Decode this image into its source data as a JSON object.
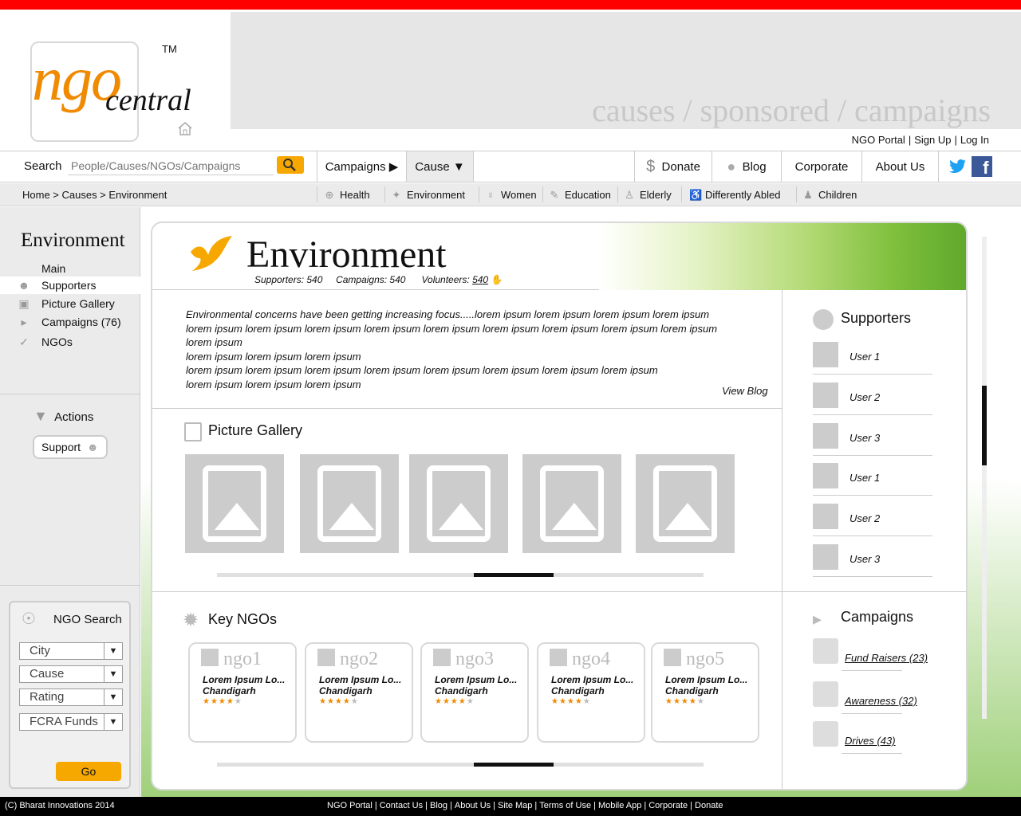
{
  "logo": {
    "word1": "ngo",
    "word2": "central",
    "tm": "TM"
  },
  "banner": {
    "tagline": "causes / sponsored / campaigns"
  },
  "top_links": [
    "NGO Portal",
    "Sign Up",
    "Log In"
  ],
  "search": {
    "label": "Search",
    "placeholder": "People/Causes/NGOs/Campaigns"
  },
  "nav": {
    "campaigns": "Campaigns",
    "cause": "Cause",
    "donate": "Donate",
    "blog": "Blog",
    "corporate": "Corporate",
    "about": "About Us"
  },
  "breadcrumb": "Home > Causes > Environment",
  "categories": [
    "Health",
    "Environment",
    "Women",
    "Education",
    "Elderly",
    "Differently Abled",
    "Children"
  ],
  "sidebar": {
    "title": "Environment",
    "items": [
      "Main",
      "Supporters",
      "Picture Gallery",
      "Campaigns (76)",
      "NGOs"
    ],
    "actions": "Actions",
    "support": "Support"
  },
  "ngo_search": {
    "title": "NGO Search",
    "filters": [
      "City",
      "Cause",
      "Rating",
      "FCRA Funds"
    ],
    "go": "Go"
  },
  "hero": {
    "title": "Environment",
    "supporters": "Supporters: 540",
    "campaigns": "Campaigns: 540",
    "volunteers_label": "Volunteers:",
    "volunteers_value": "540"
  },
  "description": [
    "Environmental concerns have been getting increasing focus.....lorem ipsum lorem ipsum lorem ipsum lorem ipsum",
    "lorem ipsum lorem ipsum lorem ipsum lorem ipsum lorem ipsum lorem ipsum lorem ipsum lorem ipsum lorem ipsum lorem ipsum",
    "lorem ipsum lorem ipsum lorem ipsum",
    "lorem ipsum lorem ipsum lorem ipsum lorem ipsum lorem ipsum lorem ipsum lorem ipsum lorem ipsum",
    "lorem ipsum lorem ipsum lorem ipsum"
  ],
  "view_blog": "View Blog",
  "gallery_title": "Picture Gallery",
  "key_ngos_title": "Key NGOs",
  "ngos": [
    {
      "name": "ngo1",
      "desc": "Lorem Ipsum Lo...",
      "city": "Chandigarh",
      "rating": 4
    },
    {
      "name": "ngo2",
      "desc": "Lorem Ipsum Lo...",
      "city": "Chandigarh",
      "rating": 4
    },
    {
      "name": "ngo3",
      "desc": "Lorem Ipsum Lo...",
      "city": "Chandigarh",
      "rating": 4
    },
    {
      "name": "ngo4",
      "desc": "Lorem Ipsum Lo...",
      "city": "Chandigarh",
      "rating": 4
    },
    {
      "name": "ngo5",
      "desc": "Lorem Ipsum Lo...",
      "city": "Chandigarh",
      "rating": 4
    }
  ],
  "supporters_title": "Supporters",
  "supporters": [
    "User 1",
    "User 2",
    "User 3",
    "User 1",
    "User 2",
    "User 3"
  ],
  "campaigns_title": "Campaigns",
  "campaigns": [
    "Fund Raisers (23)",
    "Awareness (32)",
    "Drives (43)"
  ],
  "footer": {
    "copyright": "(C) Bharat Innovations 2014",
    "links": [
      "NGO Portal",
      "Contact Us",
      "Blog",
      "About Us",
      "Site Map",
      "Terms of Use",
      "Mobile App",
      "Corporate",
      "Donate"
    ]
  },
  "colors": {
    "accent": "#f7a800",
    "brand_orange": "#f08a00",
    "top_bar": "#ff0000"
  }
}
